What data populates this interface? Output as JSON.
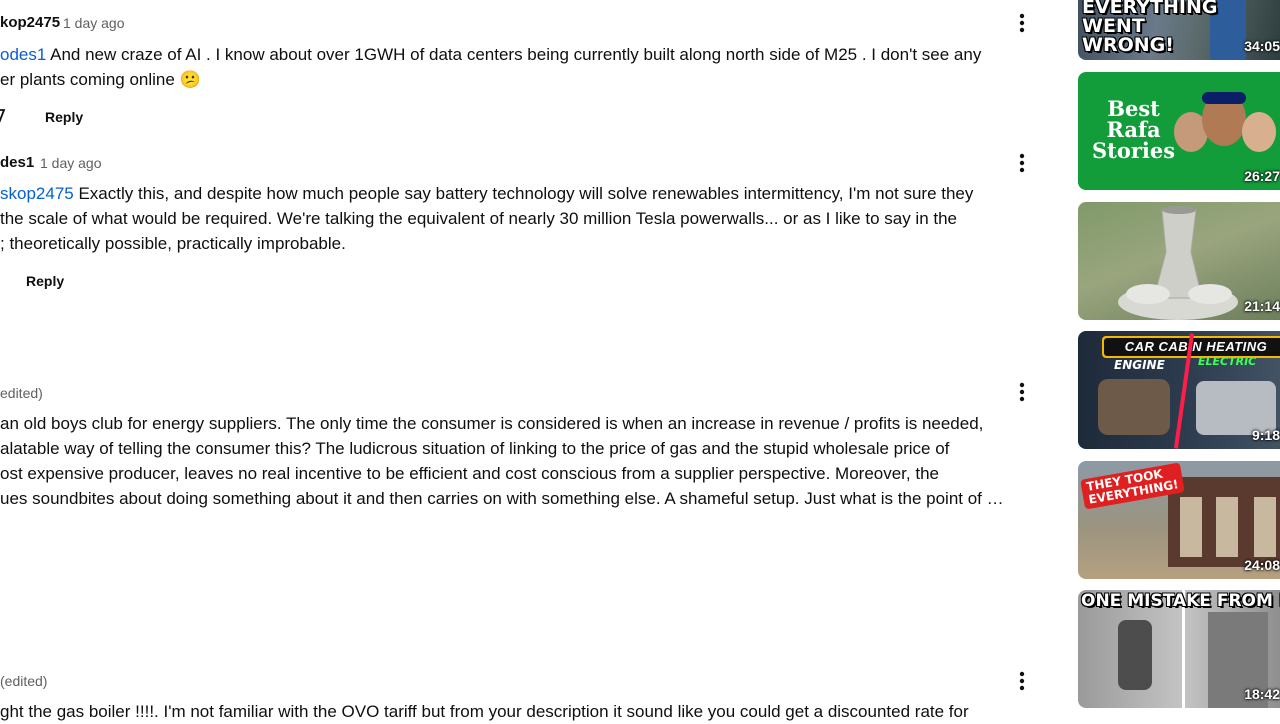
{
  "comments": [
    {
      "author": "kop2475",
      "time": "1 day ago",
      "mention": "odes1",
      "lines": [
        " And new  craze of AI . I know  about over 1GWH of data centers being currently built along north side of M25 . I don't  see any",
        "er plants coming  online 😕"
      ],
      "reply_label": "Reply"
    },
    {
      "author": "des1",
      "time": "1 day ago",
      "mention": "skop2475",
      "lines": [
        "  Exactly this, and despite how much people say battery technology will solve renewables intermittency, I'm not sure they",
        " the scale of what would be required. We're talking the equivalent of nearly 30 million Tesla powerwalls... or as I like to say in the",
        "; theoretically possible, practically improbable."
      ],
      "reply_label": "Reply"
    },
    {
      "time": "edited)",
      "lines": [
        "an old boys club for energy suppliers. The only time the consumer is considered is when an increase in revenue / profits is needed,",
        "alatable way of telling the consumer this? The ludicrous situation of linking to the price of gas and the stupid wholesale price of",
        "ost expensive producer, leaves no real incentive to be efficient and cost conscious from a supplier perspective. Moreover, the",
        "ues soundbites about doing something about it and then carries on with something else. A shameful setup. Just what is the point of …"
      ]
    },
    {
      "time": "(edited)",
      "lines": [
        "ght the gas boiler !!!!.  I'm not familiar with the OVO tariff but from your description it sound like you could get a discounted rate for"
      ]
    }
  ],
  "videos": [
    {
      "duration": "34:05",
      "title_lines": [
        "EVERYTHING",
        "WENT",
        "WRONG!"
      ]
    },
    {
      "duration": "26:27",
      "title_lines": [
        "Best",
        "Rafa",
        "Stories"
      ]
    },
    {
      "duration": "21:14"
    },
    {
      "duration": "9:18",
      "banner": "CAR CABIN HEATING",
      "label_engine": "ENGINE",
      "label_electric": "ELECTRIC"
    },
    {
      "duration": "24:08",
      "sticker_lines": [
        "THEY TOOK",
        "EVERYTHING!"
      ]
    },
    {
      "duration": "18:42",
      "banner": "ONE MISTAKE FROM DEATH"
    }
  ],
  "colors": {
    "link": "#065fd4",
    "meta": "#606060",
    "text": "#0f0f0f"
  }
}
